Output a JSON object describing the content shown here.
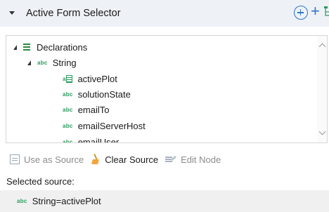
{
  "header": {
    "title": "Active Form Selector"
  },
  "tree": {
    "root": {
      "label": "Declarations"
    },
    "group": {
      "label": "String"
    },
    "items": [
      {
        "label": "activePlot",
        "type": "array"
      },
      {
        "label": "solutionState",
        "type": "abc"
      },
      {
        "label": "emailTo",
        "type": "abc"
      },
      {
        "label": "emailServerHost",
        "type": "abc"
      },
      {
        "label": "emailUser",
        "type": "abc"
      }
    ],
    "abc_badge": "abc",
    "array_badge": "a"
  },
  "toolbar": {
    "use_as_source": "Use as Source",
    "clear_source": "Clear Source",
    "edit_node": "Edit Node"
  },
  "selected": {
    "label": "Selected source:",
    "badge": "abc",
    "value": "String=activePlot"
  },
  "colors": {
    "accent": "#2f74c8",
    "badge": "#2a9a5b",
    "header_bg": "#eef2f7"
  }
}
